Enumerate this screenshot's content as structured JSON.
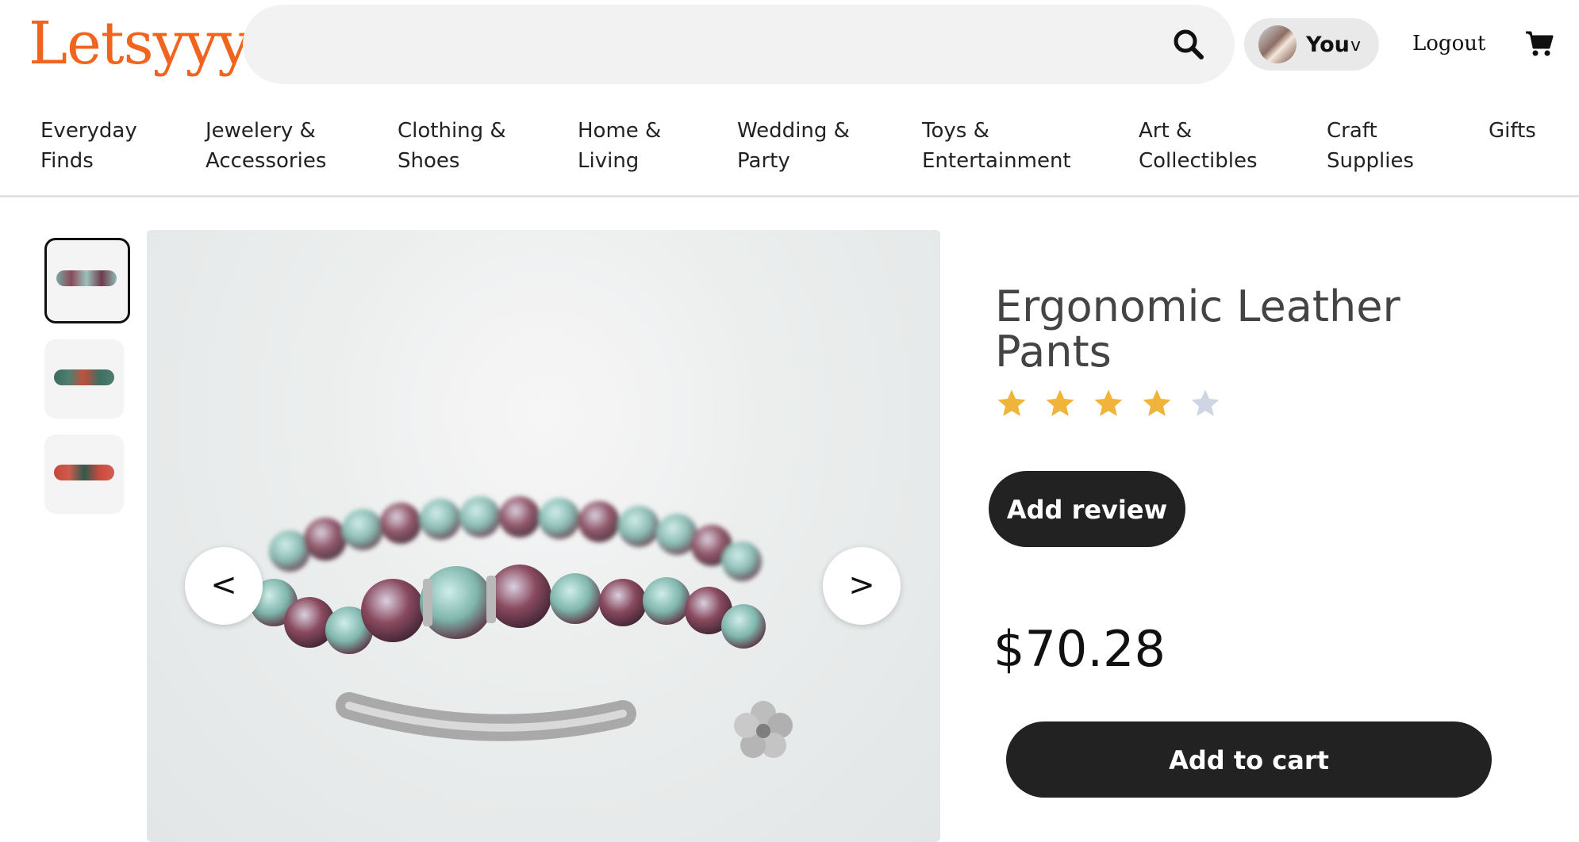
{
  "header": {
    "logo": "Letsyyy",
    "search": {
      "value": "",
      "placeholder": ""
    },
    "user": {
      "label": "You",
      "chevron": "v"
    },
    "logout_label": "Logout",
    "icons": {
      "search": "search-icon",
      "cart": "cart-icon"
    }
  },
  "categories": [
    {
      "label": "Everyday\nFinds"
    },
    {
      "label": "Jewelery &\nAccessories"
    },
    {
      "label": "Clothing &\nShoes"
    },
    {
      "label": "Home &\nLiving"
    },
    {
      "label": "Wedding &\nParty"
    },
    {
      "label": "Toys &\nEntertainment"
    },
    {
      "label": "Art &\nCollectibles"
    },
    {
      "label": "Craft\nSupplies"
    },
    {
      "label": "Gifts"
    }
  ],
  "gallery": {
    "thumbnail_count": 3,
    "active_index": 0,
    "prev_label": "<",
    "next_label": ">"
  },
  "product": {
    "title": "Ergonomic Leather Pants",
    "rating": {
      "value": 4,
      "max": 5
    },
    "add_review_label": "Add review",
    "price": "$70.28",
    "add_to_cart_label": "Add to cart"
  },
  "colors": {
    "brand": "#f1641e",
    "star_filled": "#f0b43a",
    "star_empty": "#cdd6e2",
    "button_dark": "#222222"
  }
}
